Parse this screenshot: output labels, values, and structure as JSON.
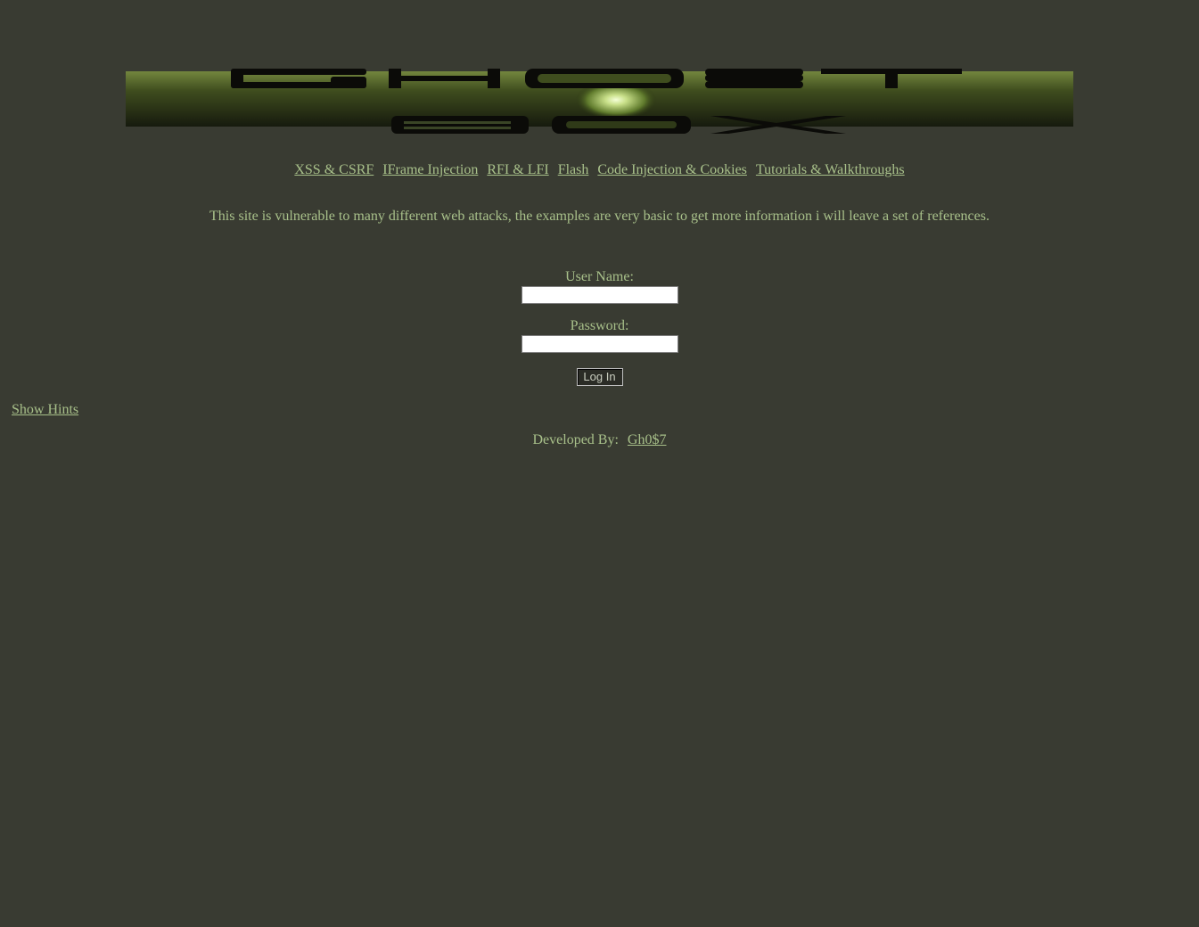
{
  "banner": {
    "logo_text": "GHOST BOX",
    "colors": {
      "bar_top": "#6b7d3a",
      "bar_bottom": "#161a0e",
      "glow": "#c9e08a",
      "letters": "#0b0b08"
    }
  },
  "nav": {
    "items": [
      {
        "label": "XSS & CSRF"
      },
      {
        "label": "IFrame Injection"
      },
      {
        "label": "RFI & LFI"
      },
      {
        "label": "Flash"
      },
      {
        "label": "Code Injection & Cookies"
      },
      {
        "label": "Tutorials & Walkthroughs"
      }
    ]
  },
  "intro": {
    "text": "This site is vulnerable to many different web attacks, the examples are very basic to get more information i will leave a set of references."
  },
  "login": {
    "username_label": "User Name:",
    "username_value": "",
    "password_label": "Password:",
    "password_value": "",
    "submit_label": "Log In"
  },
  "hints": {
    "label": "Show Hints"
  },
  "footer": {
    "developed_by": "Developed By:",
    "author": "Gh0$7"
  },
  "colors": {
    "background": "#393b32",
    "text": "#a8c08a"
  }
}
